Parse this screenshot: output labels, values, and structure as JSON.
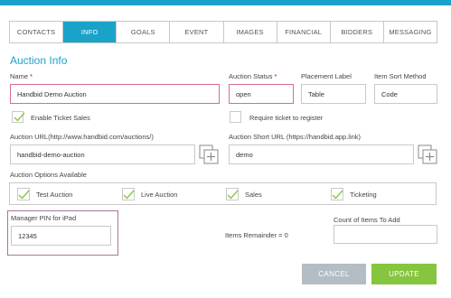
{
  "tabs": [
    "CONTACTS",
    "INFO",
    "GOALS",
    "EVENT",
    "IMAGES",
    "FINANCIAL",
    "BIDDERS",
    "MESSAGING"
  ],
  "active_tab": "INFO",
  "section_title": "Auction Info",
  "name": {
    "label": "Name",
    "required_mark": "*",
    "value": "Handbid Demo Auction"
  },
  "auction_status": {
    "label": "Auction Status",
    "required_mark": "*",
    "value": "open"
  },
  "placement_label": {
    "label": "Placement Label",
    "value": "Table"
  },
  "item_sort_method": {
    "label": "Item Sort Method",
    "value": "Code"
  },
  "enable_ticket_sales": {
    "label": "Enable Ticket Sales",
    "checked": true
  },
  "require_ticket": {
    "label": "Require ticket to register",
    "checked": false
  },
  "auction_url": {
    "label": "Auction URL(http://www.handbid.com/auctions/)",
    "value": "handbid-demo-auction"
  },
  "auction_short_url": {
    "label": "Auction Short URL (https://handbid.app.link)",
    "value": "demo"
  },
  "options": {
    "label": "Auction Options Available",
    "items": [
      {
        "label": "Test Auction",
        "checked": true
      },
      {
        "label": "Live Auction",
        "checked": true
      },
      {
        "label": "Sales",
        "checked": true
      },
      {
        "label": "Ticketing",
        "checked": true
      }
    ]
  },
  "manager_pin": {
    "label": "Manager PIN for iPad",
    "value": "12345"
  },
  "items_remainder": "Items Remainder = 0",
  "count_items_to_add": {
    "label": "Count of Items To Add",
    "value": ""
  },
  "buttons": {
    "cancel": "CANCEL",
    "update": "UPDATE"
  },
  "colors": {
    "accent": "#1aa3c8",
    "check": "#8cc63f",
    "highlight": "#d86b9b",
    "update": "#86c540",
    "cancel": "#b3bdc3"
  },
  "icons": {
    "check": "check-icon",
    "copy": "copy-add-icon"
  }
}
